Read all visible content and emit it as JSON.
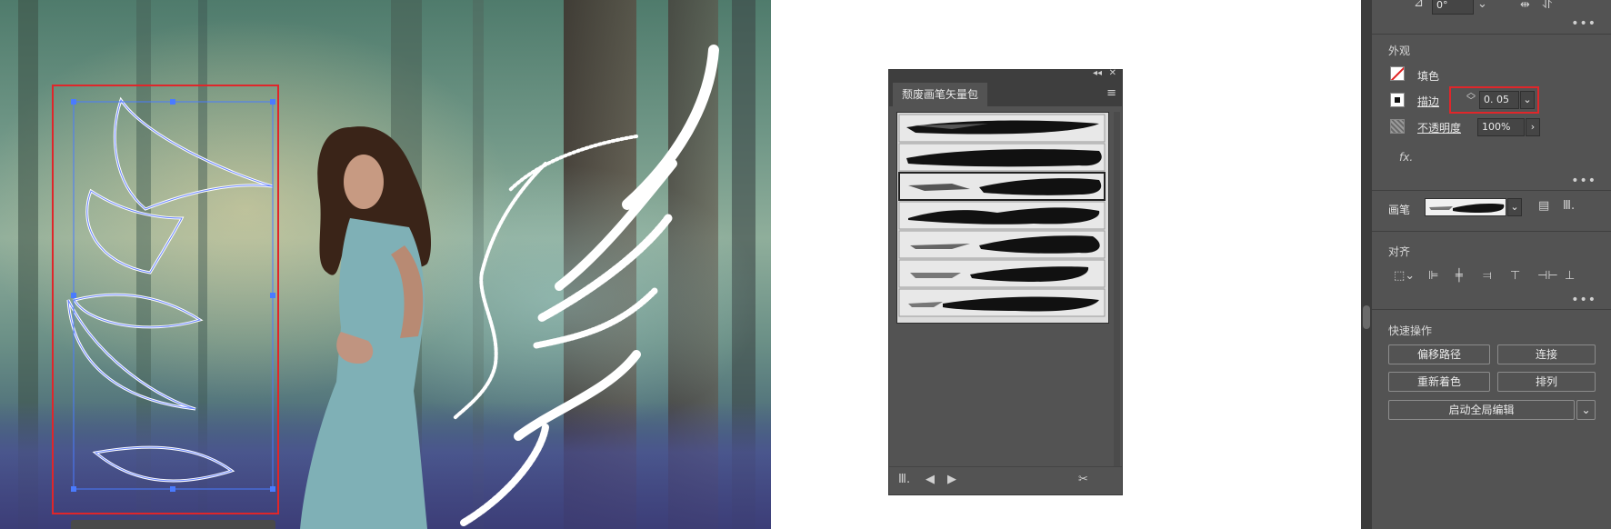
{
  "canvas": {
    "description_free": true
  },
  "brush_panel": {
    "tab_label": "颓废画笔矢量包",
    "collapse_icon": "double-chevron-left-icon",
    "close_icon": "close-icon",
    "menu_icon": "hamburger-menu-icon",
    "brush_count": 7,
    "selected_index": 2,
    "bottom_icons": [
      "brush-library-icon",
      "previous-icon",
      "next-icon",
      "remove-brush-stroke-icon"
    ]
  },
  "properties": {
    "top": {
      "angle_value": "0°"
    },
    "appearance": {
      "title": "外观",
      "fill_label": "填色",
      "stroke_label": "描边",
      "stroke_value": "0. 05",
      "opacity_label": "不透明度",
      "opacity_value": "100%",
      "fx_label": "fx."
    },
    "brush": {
      "label": "画笔"
    },
    "align": {
      "title": "对齐",
      "icons": [
        "align-to-icon",
        "align-left-icon",
        "align-horizontal-center-icon",
        "align-right-icon",
        "align-top-icon",
        "align-vertical-center-icon",
        "align-bottom-icon"
      ]
    },
    "quick_actions": {
      "title": "快速操作",
      "offset_path": "偏移路径",
      "join": "连接",
      "recolor": "重新着色",
      "arrange": "排列",
      "global_edit": "启动全局编辑"
    },
    "more_label": "•••"
  },
  "colors": {
    "panel_bg": "#535353",
    "panel_dark": "#3e3e3e",
    "highlight_red": "#e0262a",
    "selection_blue": "#4a7bff"
  }
}
